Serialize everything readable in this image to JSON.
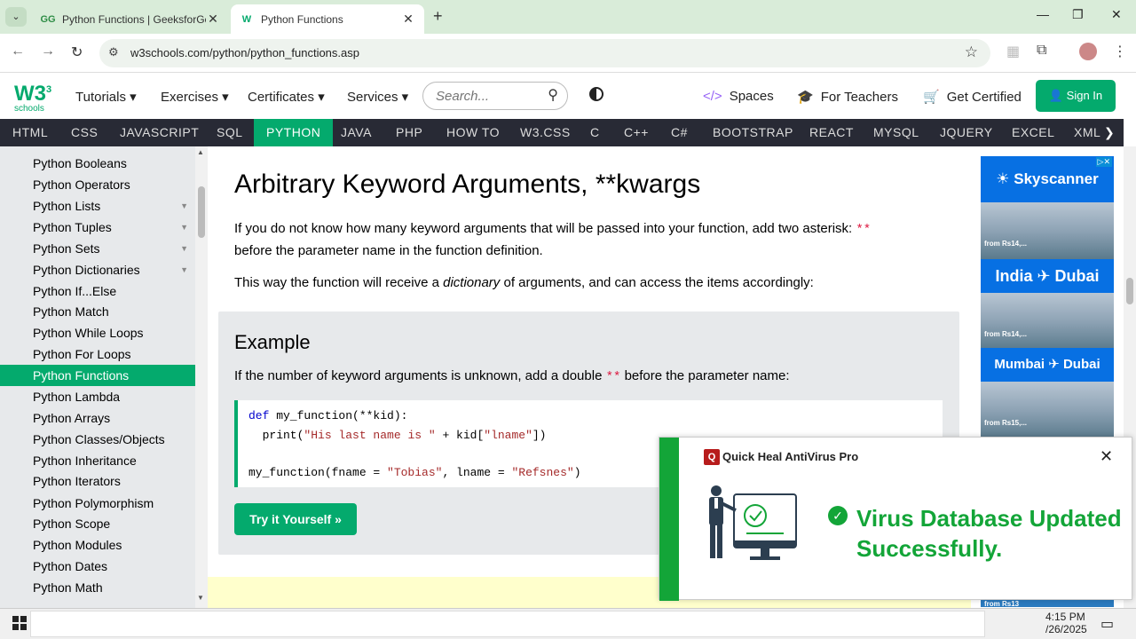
{
  "browser": {
    "tabs": [
      {
        "title": "Python Functions | GeeksforGee",
        "favicon": "gfg-icon",
        "active": false
      },
      {
        "title": "Python Functions",
        "favicon": "w3-icon",
        "active": true
      }
    ],
    "url": "w3schools.com/python/python_functions.asp"
  },
  "w3nav": {
    "logo_main": "W3",
    "logo_sub": "schools",
    "menus": [
      "Tutorials ▾",
      "Exercises ▾",
      "Certificates ▾",
      "Services ▾"
    ],
    "search_placeholder": "Search...",
    "spaces": "Spaces",
    "teachers": "For Teachers",
    "certified": "Get Certified",
    "signin": "Sign In"
  },
  "subjects": [
    "HTML",
    "CSS",
    "JAVASCRIPT",
    "SQL",
    "PYTHON",
    "JAVA",
    "PHP",
    "HOW TO",
    "W3.CSS",
    "C",
    "C++",
    "C#",
    "BOOTSTRAP",
    "REACT",
    "MYSQL",
    "JQUERY",
    "EXCEL",
    "XML"
  ],
  "active_subject": "PYTHON",
  "sidebar": {
    "items": [
      "Python Booleans",
      "Python Operators",
      "Python Lists",
      "Python Tuples",
      "Python Sets",
      "Python Dictionaries",
      "Python If...Else",
      "Python Match",
      "Python While Loops",
      "Python For Loops",
      "Python Functions",
      "Python Lambda",
      "Python Arrays",
      "Python Classes/Objects",
      "Python Inheritance",
      "Python Iterators",
      "Python Polymorphism",
      "Python Scope",
      "Python Modules",
      "Python Dates",
      "Python Math"
    ],
    "active": "Python Functions"
  },
  "content": {
    "heading": "Arbitrary Keyword Arguments, **kwargs",
    "p1a": "If you do not know how many keyword arguments that will be passed into your function, add two asterisk:",
    "p1kw": "**",
    "p1b": "before the parameter name in the function definition.",
    "p2a": "This way the function will receive a",
    "p2em": "dictionary",
    "p2b": "of arguments, and can access the items accordingly:",
    "example_heading": "Example",
    "example_desc_a": "If the number of keyword arguments is unknown, add a double",
    "example_desc_kw": "**",
    "example_desc_b": "before the parameter name:",
    "code": {
      "l1_kw": "def",
      "l1_rest": " my_function(**kid):",
      "l2_a": "  print(",
      "l2_str": "\"His last name is \"",
      "l2_b": " + kid[",
      "l2_str2": "\"lname\"",
      "l2_c": "])",
      "l3_a": "my_function(fname = ",
      "l3_str": "\"Tobias\"",
      "l3_b": ", lname = ",
      "l3_str2": "\"Refsnes\"",
      "l3_c": ")"
    },
    "tryit": "Try it Yourself »"
  },
  "ad": {
    "brand": "Skyscanner",
    "dest1": "India ✈ Dubai",
    "dest2": "Mumbai ✈ Dubai",
    "from1": "from Rs14,...",
    "from2": "from Rs14,...",
    "from3": "from Rs15,...",
    "from4": "from Rs13"
  },
  "popup": {
    "app": "Quick Heal AntiVirus Pro",
    "message_l1": "Virus Database Updated",
    "message_l2": "Successfully."
  },
  "taskbar": {
    "time": "4:15 PM",
    "date": "/26/2025"
  },
  "colors": {
    "w3green": "#04aa6d",
    "subjectbar": "#282a35",
    "sidebar": "#e7e9eb",
    "popup_green": "#13a538"
  }
}
